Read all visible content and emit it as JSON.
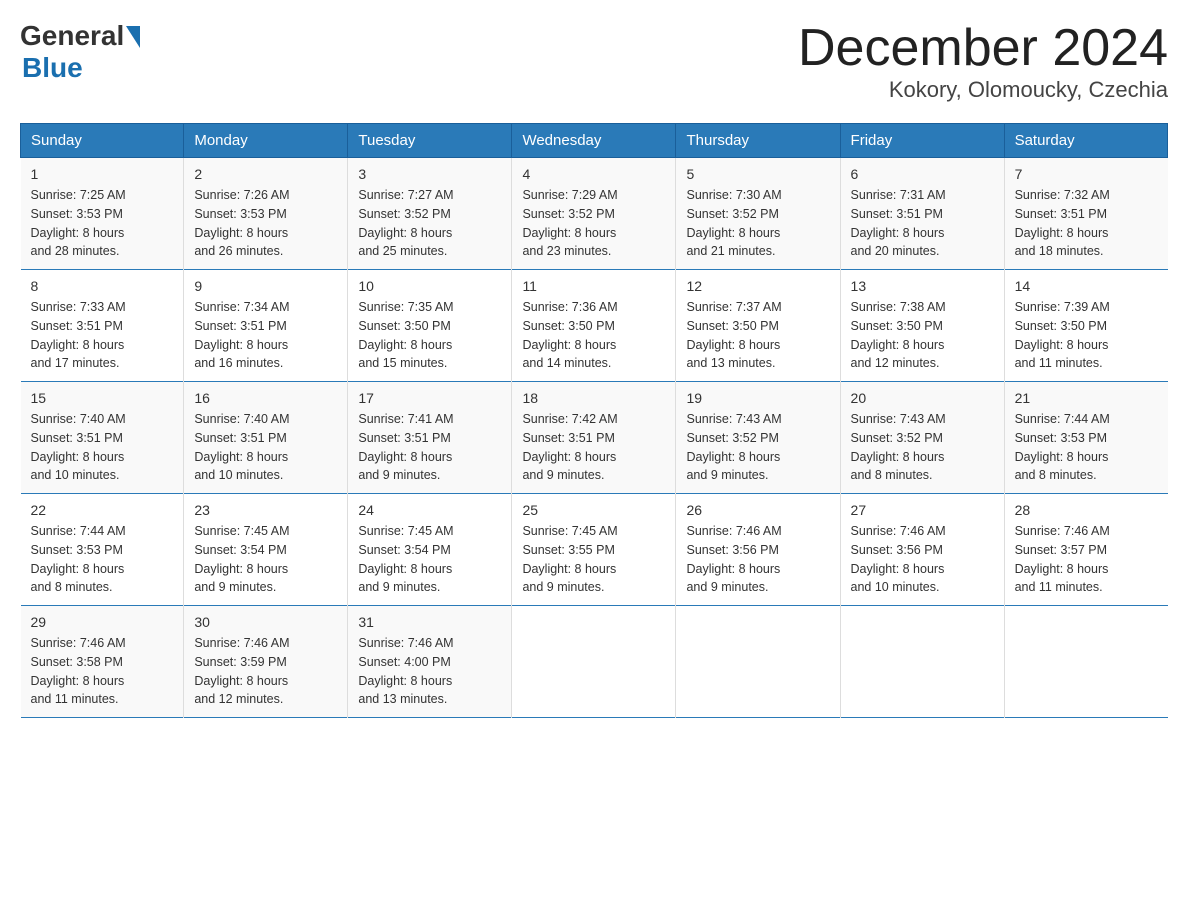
{
  "logo": {
    "general": "General",
    "blue": "Blue"
  },
  "title": "December 2024",
  "subtitle": "Kokory, Olomoucky, Czechia",
  "headers": [
    "Sunday",
    "Monday",
    "Tuesday",
    "Wednesday",
    "Thursday",
    "Friday",
    "Saturday"
  ],
  "weeks": [
    [
      {
        "day": "1",
        "sunrise": "7:25 AM",
        "sunset": "3:53 PM",
        "daylight": "8 hours and 28 minutes."
      },
      {
        "day": "2",
        "sunrise": "7:26 AM",
        "sunset": "3:53 PM",
        "daylight": "8 hours and 26 minutes."
      },
      {
        "day": "3",
        "sunrise": "7:27 AM",
        "sunset": "3:52 PM",
        "daylight": "8 hours and 25 minutes."
      },
      {
        "day": "4",
        "sunrise": "7:29 AM",
        "sunset": "3:52 PM",
        "daylight": "8 hours and 23 minutes."
      },
      {
        "day": "5",
        "sunrise": "7:30 AM",
        "sunset": "3:52 PM",
        "daylight": "8 hours and 21 minutes."
      },
      {
        "day": "6",
        "sunrise": "7:31 AM",
        "sunset": "3:51 PM",
        "daylight": "8 hours and 20 minutes."
      },
      {
        "day": "7",
        "sunrise": "7:32 AM",
        "sunset": "3:51 PM",
        "daylight": "8 hours and 18 minutes."
      }
    ],
    [
      {
        "day": "8",
        "sunrise": "7:33 AM",
        "sunset": "3:51 PM",
        "daylight": "8 hours and 17 minutes."
      },
      {
        "day": "9",
        "sunrise": "7:34 AM",
        "sunset": "3:51 PM",
        "daylight": "8 hours and 16 minutes."
      },
      {
        "day": "10",
        "sunrise": "7:35 AM",
        "sunset": "3:50 PM",
        "daylight": "8 hours and 15 minutes."
      },
      {
        "day": "11",
        "sunrise": "7:36 AM",
        "sunset": "3:50 PM",
        "daylight": "8 hours and 14 minutes."
      },
      {
        "day": "12",
        "sunrise": "7:37 AM",
        "sunset": "3:50 PM",
        "daylight": "8 hours and 13 minutes."
      },
      {
        "day": "13",
        "sunrise": "7:38 AM",
        "sunset": "3:50 PM",
        "daylight": "8 hours and 12 minutes."
      },
      {
        "day": "14",
        "sunrise": "7:39 AM",
        "sunset": "3:50 PM",
        "daylight": "8 hours and 11 minutes."
      }
    ],
    [
      {
        "day": "15",
        "sunrise": "7:40 AM",
        "sunset": "3:51 PM",
        "daylight": "8 hours and 10 minutes."
      },
      {
        "day": "16",
        "sunrise": "7:40 AM",
        "sunset": "3:51 PM",
        "daylight": "8 hours and 10 minutes."
      },
      {
        "day": "17",
        "sunrise": "7:41 AM",
        "sunset": "3:51 PM",
        "daylight": "8 hours and 9 minutes."
      },
      {
        "day": "18",
        "sunrise": "7:42 AM",
        "sunset": "3:51 PM",
        "daylight": "8 hours and 9 minutes."
      },
      {
        "day": "19",
        "sunrise": "7:43 AM",
        "sunset": "3:52 PM",
        "daylight": "8 hours and 9 minutes."
      },
      {
        "day": "20",
        "sunrise": "7:43 AM",
        "sunset": "3:52 PM",
        "daylight": "8 hours and 8 minutes."
      },
      {
        "day": "21",
        "sunrise": "7:44 AM",
        "sunset": "3:53 PM",
        "daylight": "8 hours and 8 minutes."
      }
    ],
    [
      {
        "day": "22",
        "sunrise": "7:44 AM",
        "sunset": "3:53 PM",
        "daylight": "8 hours and 8 minutes."
      },
      {
        "day": "23",
        "sunrise": "7:45 AM",
        "sunset": "3:54 PM",
        "daylight": "8 hours and 9 minutes."
      },
      {
        "day": "24",
        "sunrise": "7:45 AM",
        "sunset": "3:54 PM",
        "daylight": "8 hours and 9 minutes."
      },
      {
        "day": "25",
        "sunrise": "7:45 AM",
        "sunset": "3:55 PM",
        "daylight": "8 hours and 9 minutes."
      },
      {
        "day": "26",
        "sunrise": "7:46 AM",
        "sunset": "3:56 PM",
        "daylight": "8 hours and 9 minutes."
      },
      {
        "day": "27",
        "sunrise": "7:46 AM",
        "sunset": "3:56 PM",
        "daylight": "8 hours and 10 minutes."
      },
      {
        "day": "28",
        "sunrise": "7:46 AM",
        "sunset": "3:57 PM",
        "daylight": "8 hours and 11 minutes."
      }
    ],
    [
      {
        "day": "29",
        "sunrise": "7:46 AM",
        "sunset": "3:58 PM",
        "daylight": "8 hours and 11 minutes."
      },
      {
        "day": "30",
        "sunrise": "7:46 AM",
        "sunset": "3:59 PM",
        "daylight": "8 hours and 12 minutes."
      },
      {
        "day": "31",
        "sunrise": "7:46 AM",
        "sunset": "4:00 PM",
        "daylight": "8 hours and 13 minutes."
      },
      null,
      null,
      null,
      null
    ]
  ]
}
